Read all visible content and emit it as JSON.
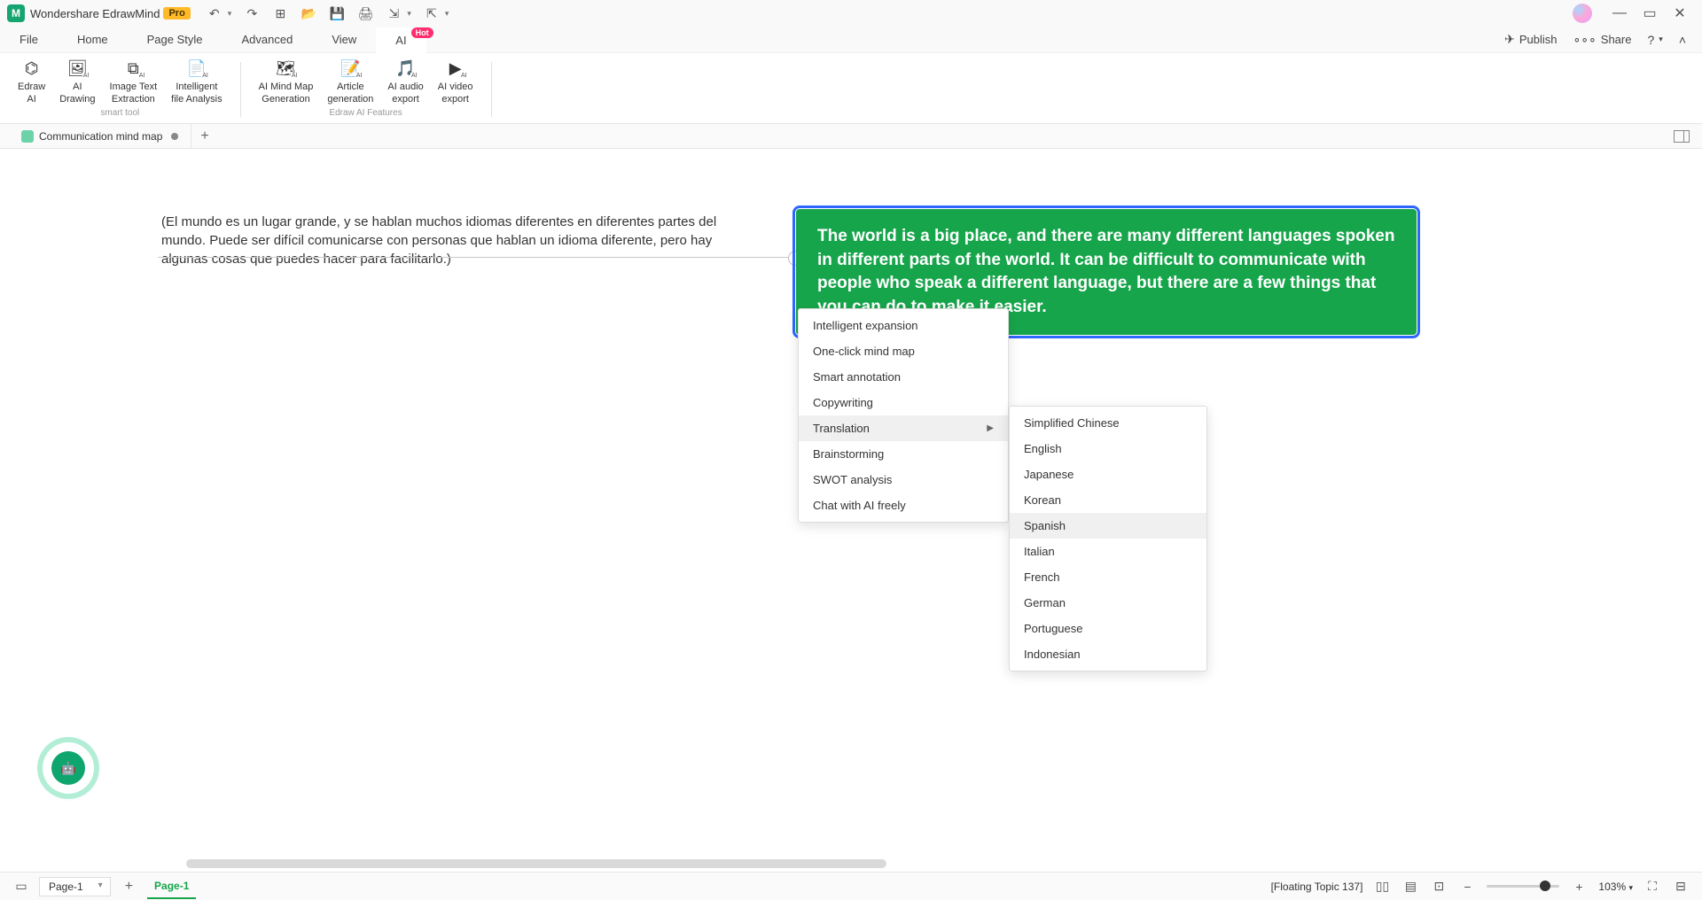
{
  "titlebar": {
    "app_name": "Wondershare EdrawMind",
    "pro": "Pro",
    "qa_icons": [
      "undo-icon",
      "redo-icon",
      "new-icon",
      "open-icon",
      "save-icon",
      "print-icon",
      "export-icon",
      "import-icon"
    ]
  },
  "menubar": {
    "items": [
      "File",
      "Home",
      "Page Style",
      "Advanced",
      "View",
      "AI"
    ],
    "active": 5,
    "hot": "Hot",
    "right": {
      "publish": "Publish",
      "share": "Share",
      "help_icon": "help-icon",
      "expand_icon": "expand-icon"
    }
  },
  "ribbon": {
    "group1_label": "smart tool",
    "group2_label": "Edraw AI Features",
    "buttons": [
      {
        "label": "Edraw\nAI",
        "icon": "edraw-ai-icon"
      },
      {
        "label": "AI\nDrawing",
        "icon": "ai-drawing-icon"
      },
      {
        "label": "Image Text\nExtraction",
        "icon": "ocr-icon"
      },
      {
        "label": "Intelligent\nfile Analysis",
        "icon": "file-analysis-icon"
      },
      {
        "label": "AI Mind Map\nGeneration",
        "icon": "mindmap-gen-icon"
      },
      {
        "label": "Article\ngeneration",
        "icon": "article-gen-icon"
      },
      {
        "label": "AI audio\nexport",
        "icon": "audio-export-icon"
      },
      {
        "label": "AI video\nexport",
        "icon": "video-export-icon"
      }
    ]
  },
  "doc_tab": {
    "name": "Communication mind map"
  },
  "canvas": {
    "spanish_text": "(El mundo es un lugar grande, y se hablan muchos idiomas diferentes en diferentes partes del mundo. Puede ser difícil comunicarse con personas que hablan un idioma diferente, pero hay algunas cosas que puedes hacer para facilitarlo.)",
    "english_text": "The world is a big place, and there are many different languages spoken in different parts of the world. It can be difficult to communicate with people who speak a different language, but there are a few things that you can do to make it easier."
  },
  "context_menu": {
    "items": [
      "Intelligent expansion",
      "One-click mind map",
      "Smart annotation",
      "Copywriting",
      "Translation",
      "Brainstorming",
      "SWOT analysis",
      "Chat with AI freely"
    ],
    "hovered": 4,
    "sub_items": [
      "Simplified Chinese",
      "English",
      "Japanese",
      "Korean",
      "Spanish",
      "Italian",
      "French",
      "German",
      "Portuguese",
      "Indonesian"
    ],
    "sub_hovered": 4
  },
  "statusbar": {
    "page_select": "Page-1",
    "page_tab": "Page-1",
    "floating_topic": "[Floating Topic 137]",
    "zoom": "103%"
  }
}
